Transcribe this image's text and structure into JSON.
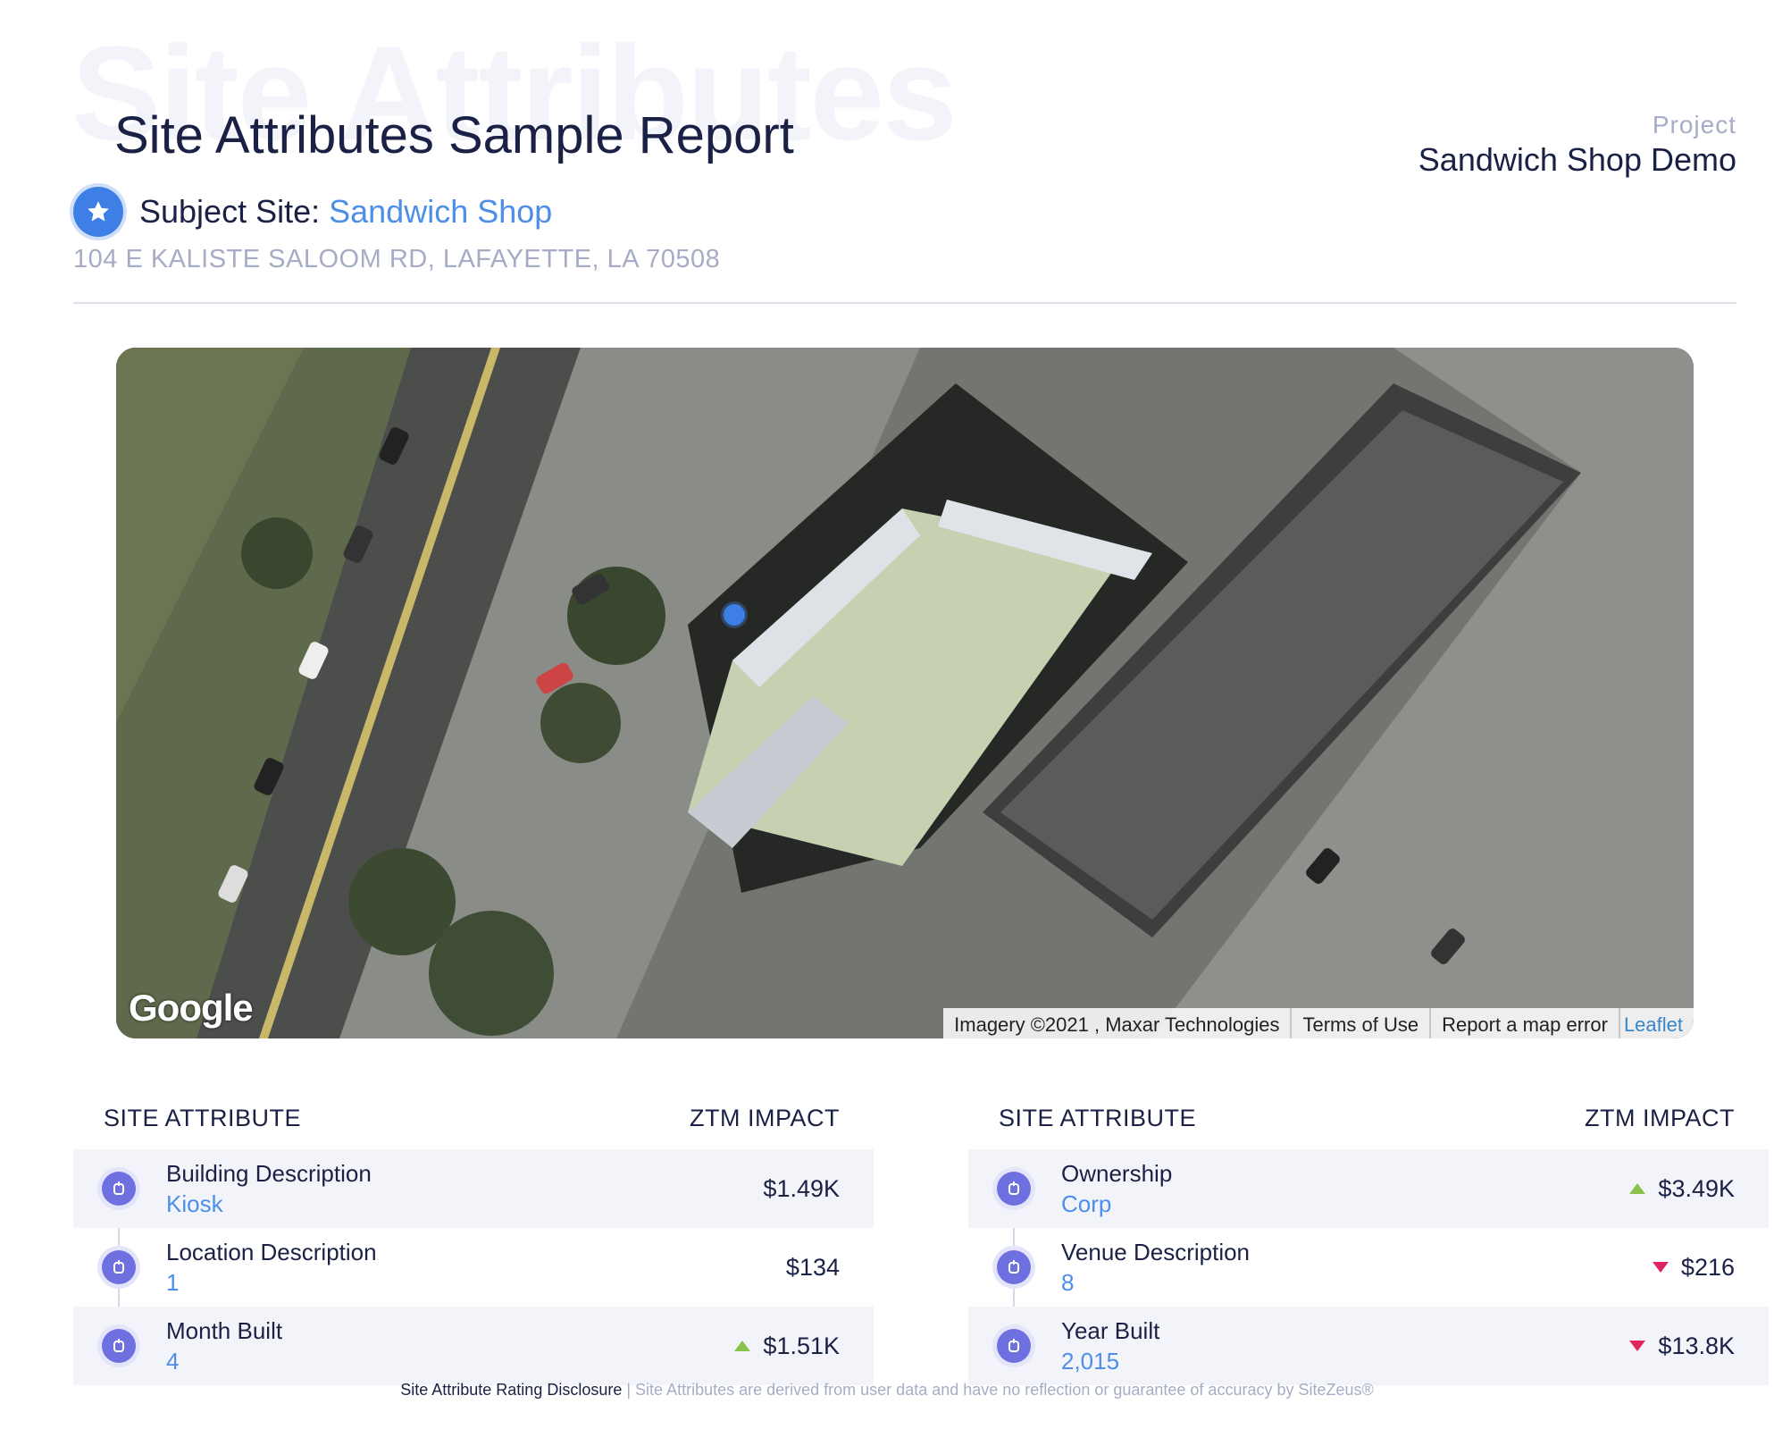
{
  "header": {
    "watermark": "Site Attributes",
    "title": "Site Attributes Sample Report",
    "project_label": "Project",
    "project_name": "Sandwich Shop Demo"
  },
  "subject": {
    "label": "Subject Site: ",
    "name": "Sandwich Shop",
    "address": "104 E KALISTE SALOOM RD, LAFAYETTE, LA 70508",
    "icon": "star-icon"
  },
  "map": {
    "logo": "Google",
    "imagery": "Imagery ©2021 , Maxar Technologies",
    "terms": "Terms of Use",
    "report": "Report a map error",
    "leaflet": "Leaflet",
    "marker_color": "#3e7fe6"
  },
  "tables": [
    {
      "header_attribute": "SITE ATTRIBUTE",
      "header_impact": "ZTM IMPACT",
      "rows": [
        {
          "name": "Building Description",
          "value": "Kiosk",
          "impact": "$1.49K",
          "trend": "none"
        },
        {
          "name": "Location Description",
          "value": "1",
          "impact": "$134",
          "trend": "none"
        },
        {
          "name": "Month Built",
          "value": "4",
          "impact": "$1.51K",
          "trend": "up"
        }
      ]
    },
    {
      "header_attribute": "SITE ATTRIBUTE",
      "header_impact": "ZTM IMPACT",
      "rows": [
        {
          "name": "Ownership",
          "value": "Corp",
          "impact": "$3.49K",
          "trend": "up"
        },
        {
          "name": "Venue Description",
          "value": "8",
          "impact": "$216",
          "trend": "down"
        },
        {
          "name": "Year Built",
          "value": "2,015",
          "impact": "$13.8K",
          "trend": "down"
        }
      ]
    }
  ],
  "colors": {
    "accent": "#4d8fe8",
    "up": "#8bc34a",
    "down": "#e0245e",
    "icon": "#6e70e0"
  },
  "disclosure": {
    "title": "Site Attribute Rating Disclosure",
    "separator": " | ",
    "text": "Site Attributes are derived from user data and have no reflection or guarantee of accuracy by SiteZeus®"
  }
}
